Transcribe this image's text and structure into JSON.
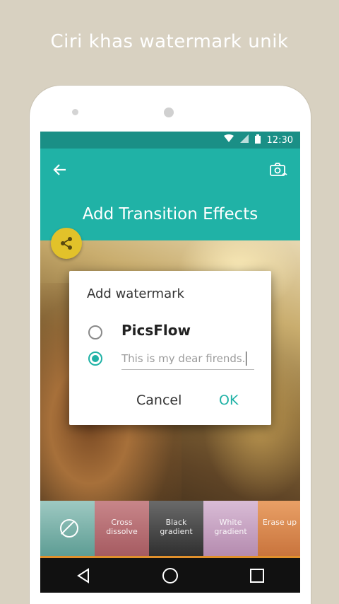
{
  "promo": {
    "title": "Ciri khas watermark unik"
  },
  "status_bar": {
    "time": "12:30"
  },
  "app_bar": {
    "title": "Add Transition Effects"
  },
  "dialog": {
    "title": "Add watermark",
    "option_preset_label": "PicsFlow",
    "option_custom_value": "This is my dear firends.",
    "selected_option": "custom",
    "cancel_label": "Cancel",
    "ok_label": "OK"
  },
  "effects": [
    {
      "label": "",
      "icon": "none-icon"
    },
    {
      "label": "Cross dissolve"
    },
    {
      "label": "Black gradient"
    },
    {
      "label": "White gradient"
    },
    {
      "label": "Erase up"
    }
  ],
  "colors": {
    "accent": "#20b2a6",
    "status_bar": "#1a8f86",
    "fab": "#e2c22a",
    "background": "#d8d1c1"
  }
}
